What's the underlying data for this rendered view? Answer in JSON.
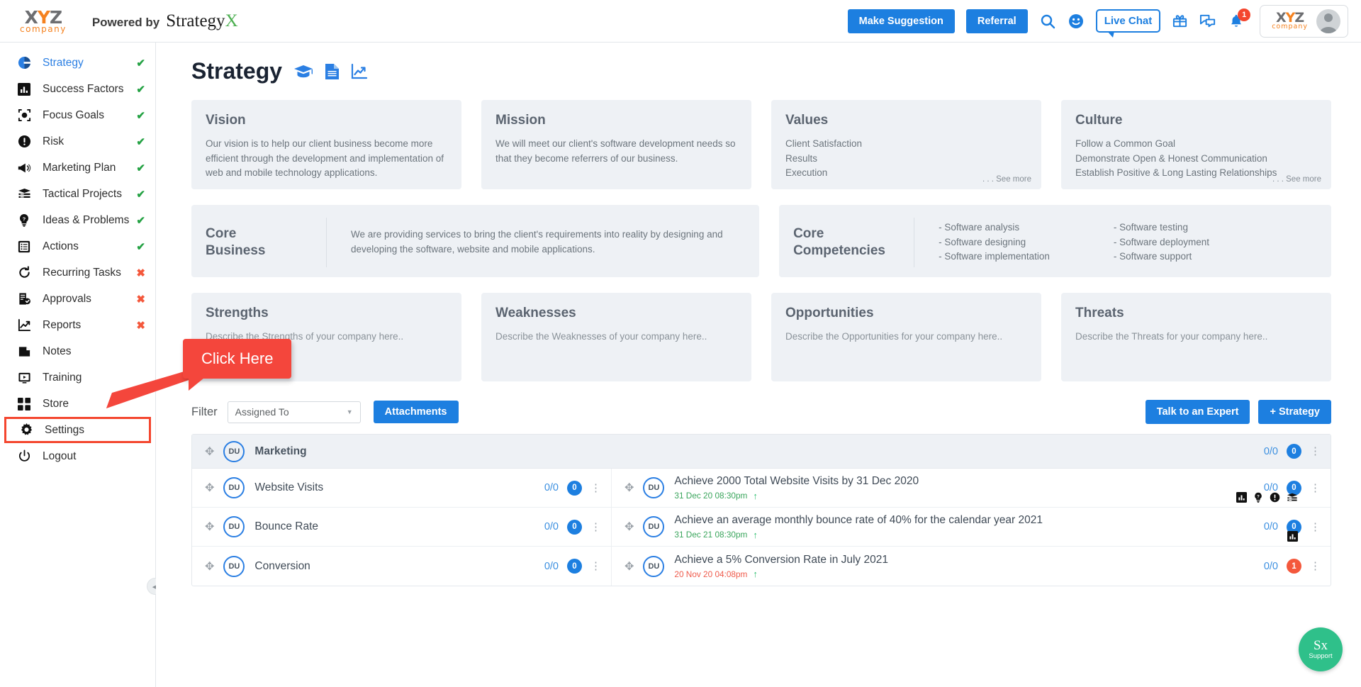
{
  "header": {
    "company_logo_top": "XYZ",
    "company_logo_bottom": "company",
    "powered_label": "Powered by",
    "powered_brand": "Strategy",
    "powered_brand_accent": "X",
    "make_suggestion": "Make Suggestion",
    "referral": "Referral",
    "live_chat": "Live Chat",
    "notification_count": "1",
    "icons": [
      "search-icon",
      "smiley-icon",
      "gift-icon",
      "chat-icon",
      "bell-icon"
    ]
  },
  "sidebar": {
    "items": [
      {
        "label": "Strategy",
        "icon": "pie-chart-icon",
        "status": "check",
        "active": true
      },
      {
        "label": "Success Factors",
        "icon": "bar-chart-icon",
        "status": "check",
        "active": false
      },
      {
        "label": "Focus Goals",
        "icon": "target-icon",
        "status": "check",
        "active": false
      },
      {
        "label": "Risk",
        "icon": "alert-icon",
        "status": "check",
        "active": false
      },
      {
        "label": "Marketing Plan",
        "icon": "megaphone-icon",
        "status": "check",
        "active": false
      },
      {
        "label": "Tactical Projects",
        "icon": "layers-icon",
        "status": "check",
        "active": false
      },
      {
        "label": "Ideas & Problems",
        "icon": "lightbulb-icon",
        "status": "check",
        "active": false
      },
      {
        "label": "Actions",
        "icon": "list-icon",
        "status": "check",
        "active": false
      },
      {
        "label": "Recurring Tasks",
        "icon": "refresh-icon",
        "status": "cross",
        "active": false
      },
      {
        "label": "Approvals",
        "icon": "approval-icon",
        "status": "cross",
        "active": false
      },
      {
        "label": "Reports",
        "icon": "trend-icon",
        "status": "cross",
        "active": false
      },
      {
        "label": "Notes",
        "icon": "note-icon",
        "status": "none",
        "active": false
      },
      {
        "label": "Training",
        "icon": "video-icon",
        "status": "none",
        "active": false
      },
      {
        "label": "Store",
        "icon": "grid-icon",
        "status": "none",
        "active": false
      },
      {
        "label": "Settings",
        "icon": "gear-icon",
        "status": "none",
        "active": false,
        "highlighted": true
      },
      {
        "label": "Logout",
        "icon": "power-icon",
        "status": "none",
        "active": false
      }
    ]
  },
  "page": {
    "title": "Strategy",
    "title_icons": [
      "graduation-cap-icon",
      "document-icon",
      "trend-chart-icon"
    ]
  },
  "cards": {
    "vision": {
      "title": "Vision",
      "body": "Our vision is to help our client business become more efficient through the development and implementation of web and mobile technology applications."
    },
    "mission": {
      "title": "Mission",
      "body": "We will meet our client's software development needs so that they become referrers of our business."
    },
    "values": {
      "title": "Values",
      "lines": [
        "Client Satisfaction",
        "Results",
        "Execution"
      ],
      "see_more": ". . . See more"
    },
    "culture": {
      "title": "Culture",
      "lines": [
        "Follow a Common Goal",
        "Demonstrate Open & Honest Communication",
        "Establish Positive & Long Lasting Relationships"
      ],
      "see_more": ". . . See more"
    },
    "core_business": {
      "title_line1": "Core",
      "title_line2": "Business",
      "body": "We are providing services to bring the client's requirements into reality by designing and developing the software, website and mobile applications."
    },
    "core_competencies": {
      "title_line1": "Core",
      "title_line2": "Competencies",
      "col1": [
        "- Software analysis",
        "- Software designing",
        "- Software implementation"
      ],
      "col2": [
        "- Software testing",
        "- Software deployment",
        "- Software support"
      ]
    },
    "strengths": {
      "title": "Strengths",
      "body": "Describe the Strengths of your company here.."
    },
    "weaknesses": {
      "title": "Weaknesses",
      "body": "Describe the Weaknesses of your company here.."
    },
    "opportunities": {
      "title": "Opportunities",
      "body": "Describe the Opportunities for your company here.."
    },
    "threats": {
      "title": "Threats",
      "body": "Describe the Threats for your company here.."
    }
  },
  "filter_bar": {
    "label": "Filter",
    "select_value": "Assigned To",
    "attachments": "Attachments",
    "talk_expert": "Talk to an Expert",
    "add_strategy": "+ Strategy"
  },
  "table": {
    "group": {
      "avatar": "DU",
      "name": "Marketing",
      "ratio": "0/0",
      "count": "0",
      "count_color": "blue"
    },
    "rows": [
      {
        "left": {
          "avatar": "DU",
          "name": "Website Visits",
          "ratio": "0/0",
          "count": "0",
          "count_color": "blue"
        },
        "right": {
          "avatar": "DU",
          "title": "Achieve 2000 Total Website Visits by 31 Dec 2020",
          "date": "31 Dec 20 08:30pm",
          "date_color": "green",
          "ratio": "0/0",
          "count": "0",
          "count_color": "blue",
          "mini_icons": [
            "bar-chart-icon",
            "lightbulb-icon",
            "alert-icon",
            "layers-icon"
          ]
        }
      },
      {
        "left": {
          "avatar": "DU",
          "name": "Bounce Rate",
          "ratio": "0/0",
          "count": "0",
          "count_color": "blue"
        },
        "right": {
          "avatar": "DU",
          "title": "Achieve an average monthly bounce rate of 40% for the calendar year 2021",
          "date": "31 Dec 21 08:30pm",
          "date_color": "green",
          "ratio": "0/0",
          "count": "0",
          "count_color": "blue",
          "mini_icons": [
            "bar-chart-icon"
          ]
        }
      },
      {
        "left": {
          "avatar": "DU",
          "name": "Conversion",
          "ratio": "0/0",
          "count": "0",
          "count_color": "blue"
        },
        "right": {
          "avatar": "DU",
          "title": "Achieve a 5% Conversion Rate in July 2021",
          "date": "20 Nov 20 04:08pm",
          "date_color": "red",
          "ratio": "0/0",
          "count": "1",
          "count_color": "red",
          "mini_icons": []
        }
      }
    ]
  },
  "callout": {
    "text": "Click Here"
  },
  "support": {
    "brand": "Sx",
    "label": "Support"
  },
  "colors": {
    "accent_blue": "#1d7fe0",
    "callout_red": "#f4463c",
    "status_ok": "#25a244",
    "status_no": "#f4583c",
    "card_bg": "#eef1f5",
    "support_green": "#2fc08a"
  }
}
